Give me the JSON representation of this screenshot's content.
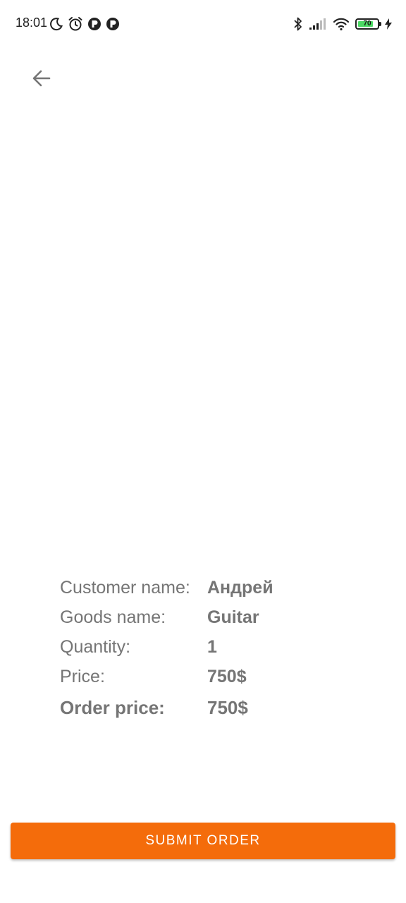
{
  "status_bar": {
    "time": "18:01",
    "battery_level": "70",
    "left_icons": [
      "moon-icon",
      "alarm-icon",
      "app-notification-icon",
      "app-notification-icon"
    ],
    "right_icons": [
      "bluetooth-icon",
      "signal-icon",
      "wifi-icon",
      "battery-icon",
      "charging-icon"
    ]
  },
  "toolbar": {
    "back_icon": "arrow-left-icon"
  },
  "order": {
    "customer_label": "Customer name:",
    "customer_value": "Андрей",
    "goods_label": "Goods name:",
    "goods_value": "Guitar",
    "quantity_label": "Quantity:",
    "quantity_value": "1",
    "price_label": "Price:",
    "price_value": "750$",
    "order_price_label": "Order price:",
    "order_price_value": "750$"
  },
  "actions": {
    "submit_label": "SUBMIT ORDER"
  },
  "colors": {
    "accent": "#f46c0b",
    "text": "#757575",
    "battery": "#4cd964"
  }
}
